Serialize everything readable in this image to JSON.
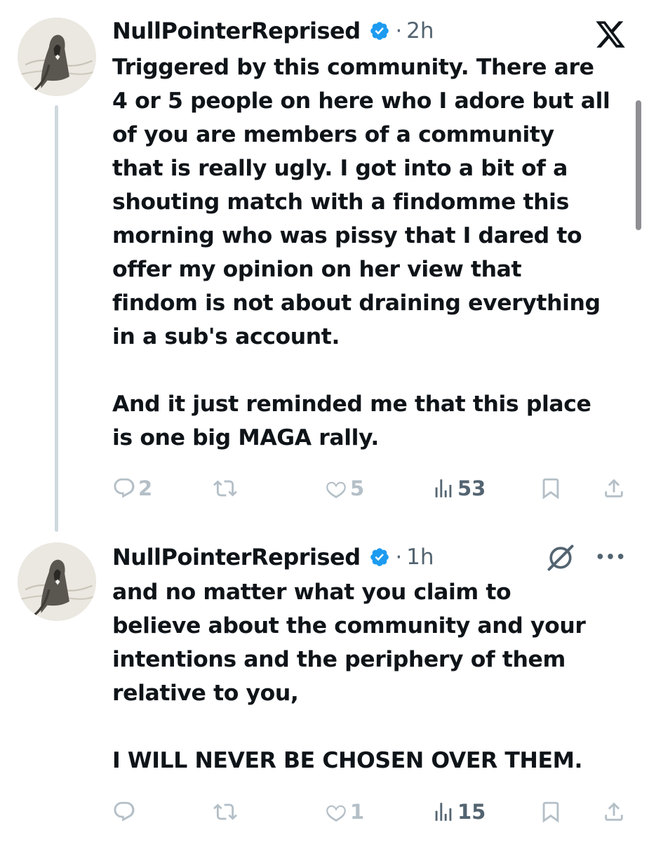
{
  "colors": {
    "text": "#0f1419",
    "muted": "#536471",
    "action": "#b4bfc7",
    "verified": "#1d9bf0",
    "thread_line": "#cfd9de"
  },
  "icons": {
    "logo": "x-logo-icon",
    "verified": "verified-badge-icon",
    "reply": "reply-icon",
    "retweet": "retweet-icon",
    "like": "heart-icon",
    "views": "views-icon",
    "bookmark": "bookmark-icon",
    "share": "share-icon",
    "grok": "grok-icon",
    "more": "more-icon"
  },
  "posts": [
    {
      "name": "NullPointerReprised",
      "separator": "·",
      "time": "2h",
      "text": "Triggered by this community. There are\n4 or 5 people on here who I adore but all\nof you are members of a community\nthat is really ugly. I got into a bit of a\nshouting match with a findomme this\nmorning who was pissy that I dared to\noffer my opinion on her view that\nfindom is not about draining everything\nin a sub's account.\n\nAnd it just reminded me that this place\nis one big MAGA rally.",
      "replies": "2",
      "reposts": "",
      "likes": "5",
      "views": "53"
    },
    {
      "name": "NullPointerReprised",
      "separator": "·",
      "time": "1h",
      "text": "and no matter what you claim to\nbelieve about the community and your\nintentions and the periphery of them\nrelative to you,\n\nI WILL NEVER BE CHOSEN OVER THEM.",
      "replies": "",
      "reposts": "",
      "likes": "1",
      "views": "15"
    }
  ]
}
